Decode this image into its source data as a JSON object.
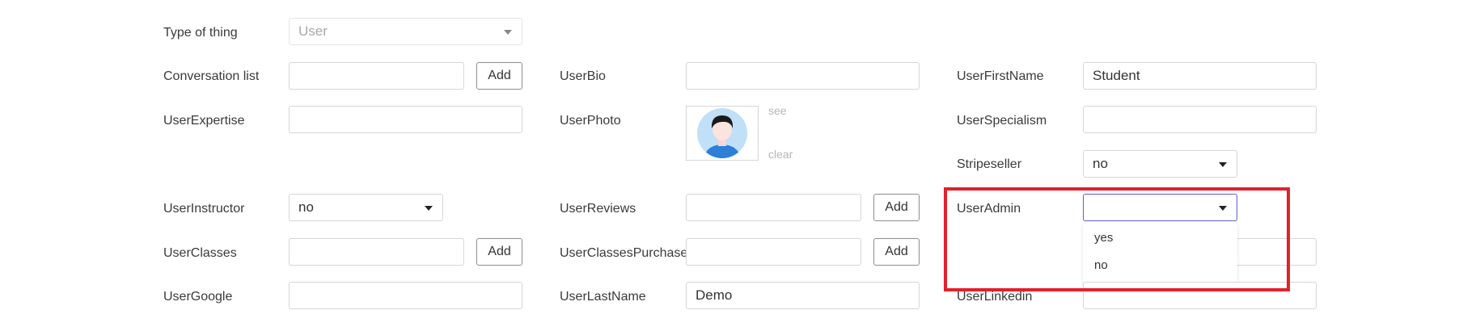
{
  "form": {
    "col1": {
      "type_of_thing": {
        "label": "Type of thing",
        "value": "User"
      },
      "conversation_list": {
        "label": "Conversation list",
        "value": "",
        "button": "Add"
      },
      "user_expertise": {
        "label": "UserExpertise",
        "value": ""
      },
      "user_instructor": {
        "label": "UserInstructor",
        "value": "no"
      },
      "user_classes": {
        "label": "UserClasses",
        "value": "",
        "button": "Add"
      },
      "user_google": {
        "label": "UserGoogle",
        "value": ""
      }
    },
    "col2": {
      "user_bio": {
        "label": "UserBio",
        "value": ""
      },
      "user_photo": {
        "label": "UserPhoto",
        "see": "see",
        "clear": "clear"
      },
      "user_reviews": {
        "label": "UserReviews",
        "value": "",
        "button": "Add"
      },
      "user_classes_purchased": {
        "label": "UserClassesPurchased",
        "value": "",
        "button": "Add"
      },
      "user_last_name": {
        "label": "UserLastName",
        "value": "Demo"
      }
    },
    "col3": {
      "user_first_name": {
        "label": "UserFirstName",
        "value": "Student"
      },
      "user_specialism": {
        "label": "UserSpecialism",
        "value": ""
      },
      "stripeseller": {
        "label": "Stripeseller",
        "value": "no"
      },
      "user_admin": {
        "label": "UserAdmin",
        "value": "",
        "options": [
          "yes",
          "no"
        ]
      },
      "user_linkedin": {
        "label": "UserLinkedin",
        "value": ""
      }
    }
  },
  "colors": {
    "highlight": "#e3202b",
    "focus_border": "#5b5fd6",
    "avatar_bg": "#bfe0f7",
    "avatar_shirt": "#2d7fd8"
  }
}
